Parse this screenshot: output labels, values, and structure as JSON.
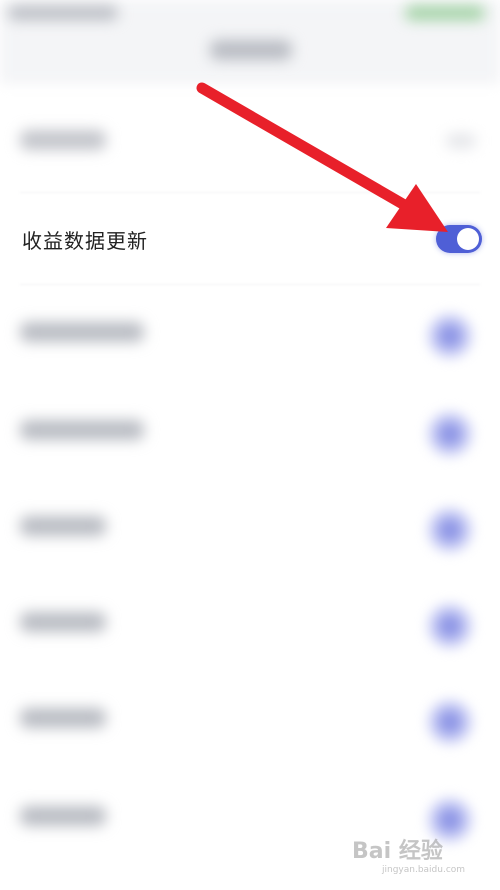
{
  "settings": {
    "revenue_row": {
      "label": "收益数据更新",
      "toggle_on": true
    }
  },
  "colors": {
    "toggle_on": "#4f5fd6",
    "arrow": "#e8202a"
  },
  "watermark": {
    "text": "Bai 经验",
    "sub": "jingyan.baidu.com"
  }
}
